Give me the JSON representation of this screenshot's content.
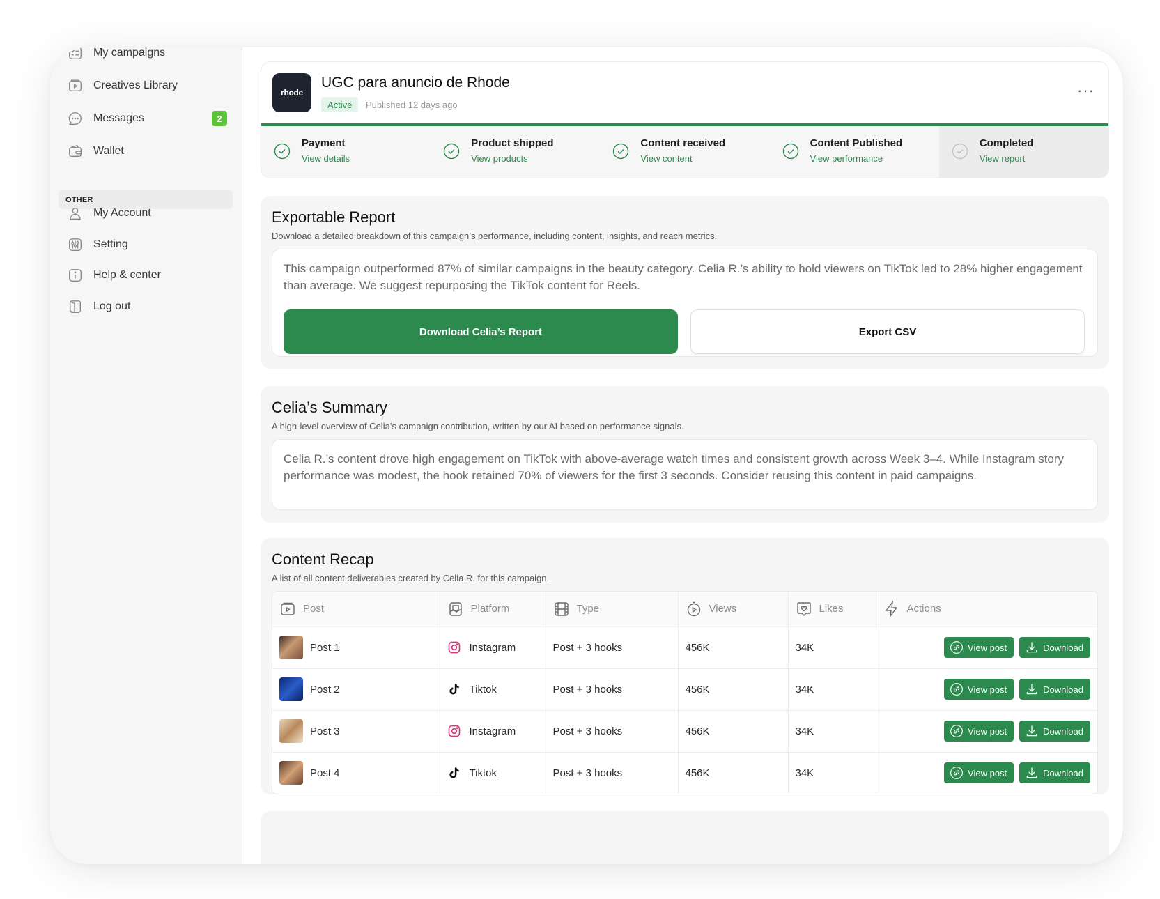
{
  "sidebar": {
    "items": [
      {
        "label": "My campaigns",
        "icon": "checklist-icon"
      },
      {
        "label": "Creatives Library",
        "icon": "video-folder-icon"
      },
      {
        "label": "Messages",
        "icon": "chat-icon",
        "badge": "2"
      },
      {
        "label": "Wallet",
        "icon": "wallet-icon"
      }
    ],
    "other_label": "OTHER",
    "other_items": [
      {
        "label": "My Account",
        "icon": "user-icon"
      },
      {
        "label": "Setting",
        "icon": "sliders-icon"
      },
      {
        "label": "Help & center",
        "icon": "info-icon"
      },
      {
        "label": "Log out",
        "icon": "logout-icon"
      }
    ]
  },
  "campaign": {
    "logo_text": "rhode",
    "title": "UGC para anuncio de Rhode",
    "status": "Active",
    "published": "Published 12 days ago",
    "more": "···"
  },
  "steps": [
    {
      "title": "Payment",
      "link": "View details",
      "done": true
    },
    {
      "title": "Product shipped",
      "link": "View products",
      "done": true
    },
    {
      "title": "Content received",
      "link": "View content",
      "done": true
    },
    {
      "title": "Content Published",
      "link": "View performance",
      "done": true
    },
    {
      "title": "Completed",
      "link": "View report",
      "done": false
    }
  ],
  "report": {
    "title": "Exportable Report",
    "subtitle": "Download a detailed breakdown of this campaign’s performance, including content, insights, and reach metrics.",
    "text": "This campaign outperformed 87% of similar campaigns in the beauty category. Celia R.’s ability to hold viewers on TikTok led to 28% higher engagement than average. We suggest repurposing the TikTok content for Reels.",
    "primary_button": "Download Celia’s Report",
    "secondary_button": "Export CSV"
  },
  "summary": {
    "title": "Celia’s Summary",
    "subtitle": "A high-level overview of Celia’s campaign contribution, written by our AI based on performance signals.",
    "text": "Celia R.’s content drove high engagement on TikTok with above-average watch times and consistent growth across Week 3–4. While Instagram story performance was modest, the hook retained 70% of viewers for the first 3 seconds. Consider reusing this content in paid campaigns."
  },
  "recap": {
    "title": "Content Recap",
    "subtitle": "A list of all content deliverables created by Celia R. for this campaign.",
    "columns": [
      "Post",
      "Platform",
      "Type",
      "Views",
      "Likes",
      "Actions"
    ],
    "view_label": "View post",
    "download_label": "Download",
    "rows": [
      {
        "post": "Post 1",
        "platform": "Instagram",
        "platform_icon": "instagram-icon",
        "type": "Post + 3 hooks",
        "views": "456K",
        "likes": "34K"
      },
      {
        "post": "Post 2",
        "platform": "Tiktok",
        "platform_icon": "tiktok-icon",
        "type": "Post + 3 hooks",
        "views": "456K",
        "likes": "34K"
      },
      {
        "post": "Post 3",
        "platform": "Instagram",
        "platform_icon": "instagram-icon",
        "type": "Post + 3 hooks",
        "views": "456K",
        "likes": "34K"
      },
      {
        "post": "Post 4",
        "platform": "Tiktok",
        "platform_icon": "tiktok-icon",
        "type": "Post + 3 hooks",
        "views": "456K",
        "likes": "34K"
      }
    ]
  },
  "colors": {
    "accent": "#2c8a4f",
    "badge": "#5cc33b",
    "status_bg": "#e4f4e8"
  }
}
